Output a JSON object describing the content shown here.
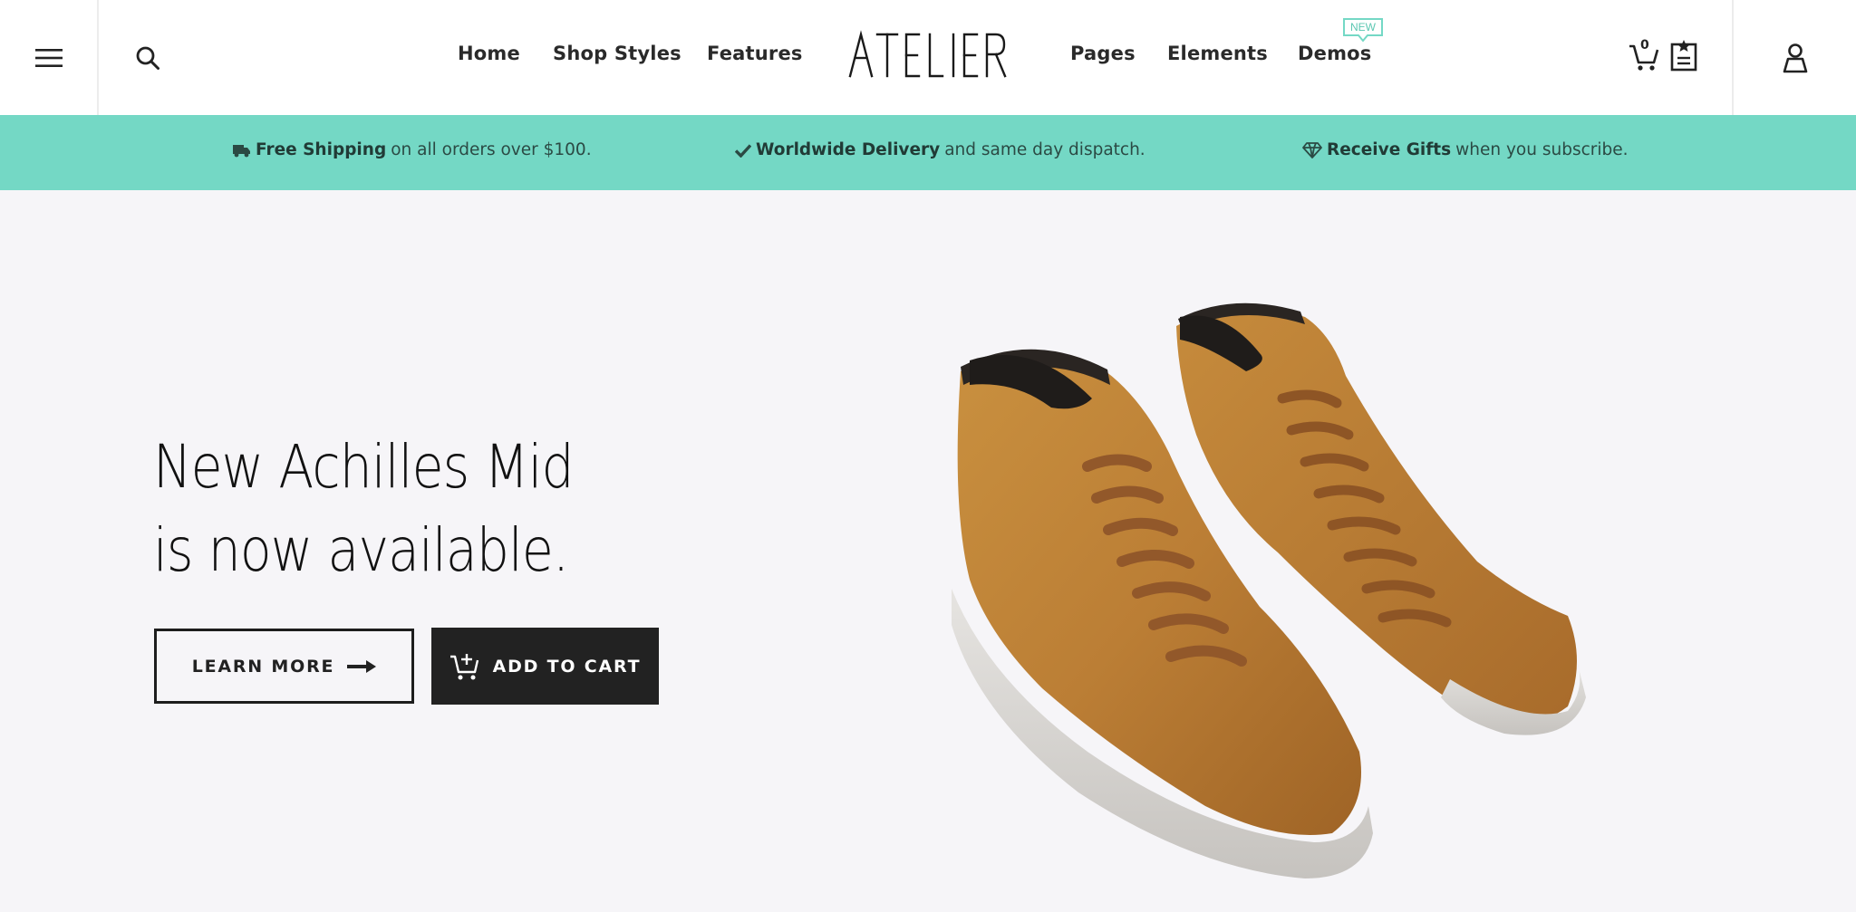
{
  "header": {
    "nav_left": [
      "Home",
      "Shop Styles",
      "Features"
    ],
    "logo_text": "ATELIER",
    "nav_right": [
      "Pages",
      "Elements",
      "Demos"
    ],
    "new_badge": "NEW",
    "cart_count": "0",
    "icons": [
      "hamburger-menu-icon",
      "search-icon",
      "cart-icon",
      "wishlist-icon",
      "user-icon"
    ]
  },
  "infobar": {
    "items": [
      {
        "icon": "truck-icon",
        "bold": "Free Shipping",
        "text": "on all orders over $100."
      },
      {
        "icon": "check-icon",
        "bold": "Worldwide Delivery",
        "text": "and same day dispatch."
      },
      {
        "icon": "diamond-icon",
        "bold": "Receive Gifts",
        "text": "when you subscribe."
      }
    ]
  },
  "hero": {
    "title_line1": "New Achilles Mid",
    "title_line2": "is now available.",
    "learn_more": "LEARN MORE",
    "add_to_cart": "ADD TO CART",
    "image": "brown-suede-high-top-sneakers"
  },
  "colors": {
    "accent": "#74d8c5",
    "dark_button": "#222222",
    "page_bg": "#f6f5f8",
    "suede": "#c0833a"
  }
}
